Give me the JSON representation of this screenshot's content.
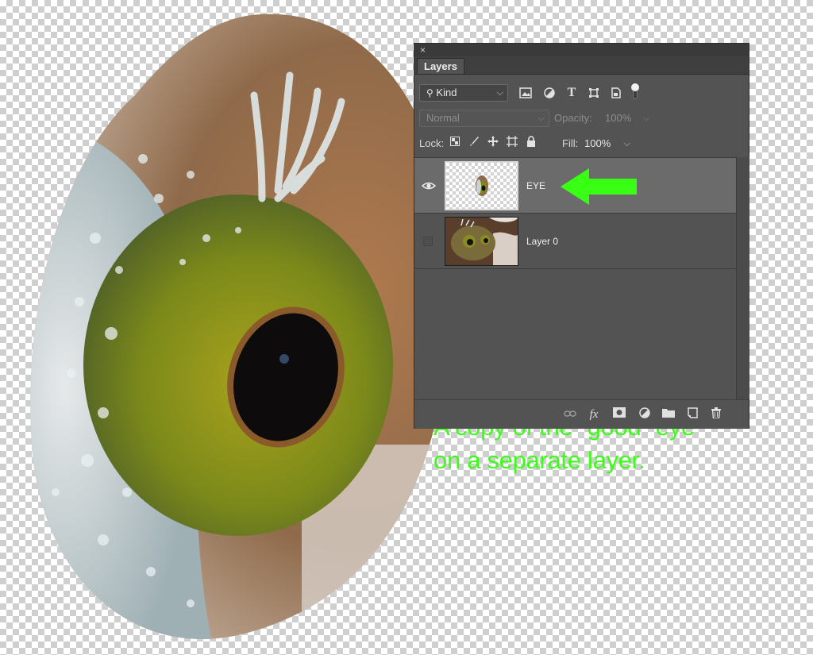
{
  "panel": {
    "close_glyph": "×",
    "tab_label": "Layers",
    "filter": {
      "kind_label": "Kind",
      "icons": [
        "image-filter-icon",
        "adjustment-filter-icon",
        "type-filter-icon",
        "shape-filter-icon",
        "smart-object-filter-icon"
      ],
      "type_glyph": "T"
    },
    "blend": {
      "mode": "Normal",
      "opacity_label": "Opacity:",
      "opacity_value": "100%"
    },
    "lock": {
      "label": "Lock:",
      "fill_label": "Fill:",
      "fill_value": "100%"
    },
    "layers": [
      {
        "name": "EYE",
        "visible": true,
        "selected": true
      },
      {
        "name": "Layer 0",
        "visible": false,
        "selected": false
      }
    ],
    "bottom_icons": [
      "link-icon",
      "fx-icon",
      "mask-icon",
      "adjustment-icon",
      "folder-icon",
      "new-layer-icon",
      "trash-icon"
    ],
    "fx_label": "fx"
  },
  "annotation": {
    "line1": "A copy of the “good” eye",
    "line2": "on a separate layer."
  },
  "colors": {
    "annotation": "#39ff14",
    "panel_bg": "#535353",
    "selected_row": "#6b6b6b"
  }
}
